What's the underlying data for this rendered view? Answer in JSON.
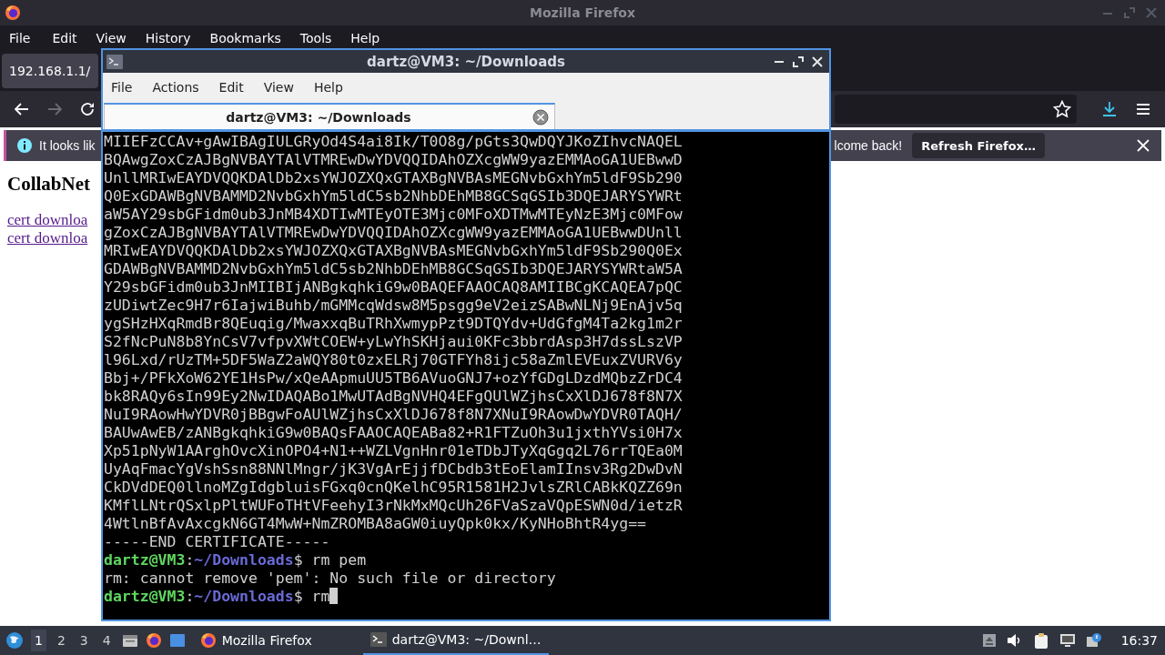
{
  "firefox": {
    "title": "Mozilla Firefox",
    "menu": [
      "File",
      "Edit",
      "View",
      "History",
      "Bookmarks",
      "Tools",
      "Help"
    ],
    "tab": {
      "title": "192.168.1.1/"
    },
    "nav": {
      "forward_disabled": true
    },
    "notification": {
      "text": "It looks lik",
      "text_continued": "lcome back!",
      "button": "Refresh Firefox…"
    },
    "page": {
      "heading": "CollabNet",
      "links": [
        "cert downloa",
        "cert downloa"
      ]
    }
  },
  "terminal": {
    "title": "dartz@VM3: ~/Downloads",
    "menu": [
      "File",
      "Actions",
      "Edit",
      "View",
      "Help"
    ],
    "tab": {
      "title": "dartz@VM3: ~/Downloads"
    },
    "lines": [
      {
        "kind": "output",
        "text": "MIIEFzCCAv+gAwIBAgIULGRyOd4S4ai8Ik/T0O8g/pGts3QwDQYJKoZIhvcNAQEL"
      },
      {
        "kind": "output",
        "text": "BQAwgZoxCzAJBgNVBAYTAlVTMREwDwYDVQQIDAhOZXcgWW9yazEMMAoGA1UEBwwD"
      },
      {
        "kind": "output",
        "text": "UnllMRIwEAYDVQQKDAlDb2xsYWJOZXQxGTAXBgNVBAsMEGNvbGxhYm5ldF9Sb290"
      },
      {
        "kind": "output",
        "text": "Q0ExGDAWBgNVBAMMD2NvbGxhYm5ldC5sb2NhbDEhMB8GCSqGSIb3DQEJARYSYWRt"
      },
      {
        "kind": "output",
        "text": "aW5AY29sbGFidm0ub3JnMB4XDTIwMTEyOTE3Mjc0MFoXDTMwMTEyNzE3Mjc0MFow"
      },
      {
        "kind": "output",
        "text": "gZoxCzAJBgNVBAYTAlVTMREwDwYDVQQIDAhOZXcgWW9yazEMMAoGA1UEBwwDUnll"
      },
      {
        "kind": "output",
        "text": "MRIwEAYDVQQKDAlDb2xsYWJOZXQxGTAXBgNVBAsMEGNvbGxhYm5ldF9Sb290Q0Ex"
      },
      {
        "kind": "output",
        "text": "GDAWBgNVBAMMD2NvbGxhYm5ldC5sb2NhbDEhMB8GCSqGSIb3DQEJARYSYWRtaW5A"
      },
      {
        "kind": "output",
        "text": "Y29sbGFidm0ub3JnMIIBIjANBgkqhkiG9w0BAQEFAAOCAQ8AMIIBCgKCAQEA7pQC"
      },
      {
        "kind": "output",
        "text": "zUDiwtZec9H7r6IajwiBuhb/mGMMcqWdsw8M5psgg9eV2eizSABwNLNj9EnAjv5q"
      },
      {
        "kind": "output",
        "text": "ygSHzHXqRmdBr8QEuqig/MwaxxqBuTRhXwmypPzt9DTQYdv+UdGfgM4Ta2kg1m2r"
      },
      {
        "kind": "output",
        "text": "S2fNcPuN8b8YnCsV7vfpvXWtCOEW+yLwYhSKHjaui0KFc3bbrdAsp3H7dssLszVP"
      },
      {
        "kind": "output",
        "text": "l96Lxd/rUzTM+5DF5WaZ2aWQY80t0zxELRj70GTFYh8ijc58aZmlEVEuxZVURV6y"
      },
      {
        "kind": "output",
        "text": "Bbj+/PFkXoW62YE1HsPw/xQeAApmuUU5TB6AVuoGNJ7+ozYfGDgLDzdMQbzZrDC4"
      },
      {
        "kind": "output",
        "text": "bk8RAQy6sIn99Ey2NwIDAQABo1MwUTAdBgNVHQ4EFgQUlWZjhsCxXlDJ678f8N7X"
      },
      {
        "kind": "output",
        "text": "NuI9RAowHwYDVR0jBBgwFoAUlWZjhsCxXlDJ678f8N7XNuI9RAowDwYDVR0TAQH/"
      },
      {
        "kind": "output",
        "text": "BAUwAwEB/zANBgkqhkiG9w0BAQsFAAOCAQEABa82+R1FTZuOh3u1jxthYVsi0H7x"
      },
      {
        "kind": "output",
        "text": "Xp51pNyW1AArghOvcXinOPO4+N1++WZLVgnHnr01eTDbJTyXqGgq2L76rrTQEa0M"
      },
      {
        "kind": "output",
        "text": "UyAqFmacYgVshSsn88NNlMngr/jK3VgArEjjfDCbdb3tEoElamIInsv3Rg2DwDvN"
      },
      {
        "kind": "output",
        "text": "CkDVdDEQ0llnoMZgIdgbluisFGxq0cnQKelhC95R1581H2JvlsZRlCABkKQZZ69n"
      },
      {
        "kind": "output",
        "text": "KMflLNtrQSxlpPltWUFoTHtVFeehyI3rNkMxMQcUh26FVaSzaVQpESWN0d/ietzR"
      },
      {
        "kind": "output",
        "text": "4WtlnBfAvAxcgkN6GT4MwW+NmZROMBA8aGW0iuyQpk0kx/KyNHoBhtR4yg=="
      },
      {
        "kind": "output",
        "text": "-----END CERTIFICATE-----"
      },
      {
        "kind": "prompt",
        "user": "dartz@VM3",
        "separator": ":",
        "path": "~/Downloads",
        "sign": "$",
        "command": "rm pem",
        "cursor": false
      },
      {
        "kind": "output",
        "text": "rm: cannot remove 'pem': No such file or directory"
      },
      {
        "kind": "prompt",
        "user": "dartz@VM3",
        "separator": ":",
        "path": "~/Downloads",
        "sign": "$",
        "command": "rm",
        "cursor": true
      }
    ]
  },
  "taskbar": {
    "workspaces": [
      {
        "label": "1",
        "selected": true
      },
      {
        "label": "2",
        "selected": false
      },
      {
        "label": "3",
        "selected": false
      },
      {
        "label": "4",
        "selected": false
      }
    ],
    "tasks": [
      {
        "kind": "firefox",
        "label": "Mozilla Firefox",
        "selected": false
      },
      {
        "kind": "terminal",
        "label": "dartz@VM3: ~/Downl…",
        "selected": true
      }
    ],
    "clock": "16:37"
  }
}
